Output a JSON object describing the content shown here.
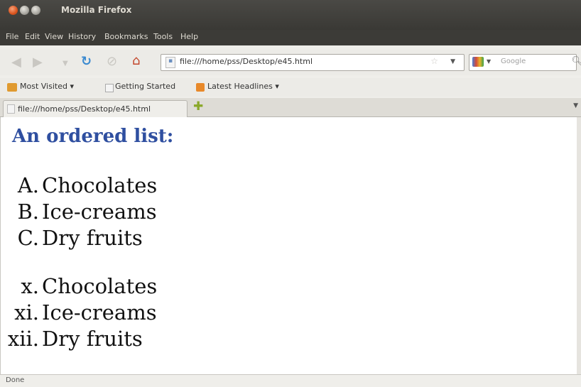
{
  "window": {
    "title": "Mozilla Firefox"
  },
  "menu": [
    "File",
    "Edit",
    "View",
    "History",
    "Bookmarks",
    "Tools",
    "Help"
  ],
  "navigation": {
    "url": "file:///home/pss/Desktop/e45.html",
    "search_placeholder": "Google",
    "icons": [
      "back-icon",
      "forward-icon",
      "history-dropdown-icon",
      "reload-icon",
      "stop-icon",
      "home-icon"
    ]
  },
  "bookmarks": {
    "items": [
      "Most Visited ▾",
      "Getting Started",
      "Latest Headlines ▾"
    ]
  },
  "tab": {
    "label": "file:///home/pss/Desktop/e45.html",
    "new_tab_icon": "plus-icon"
  },
  "page": {
    "heading": "An ordered list:",
    "list_upper_alpha": [
      {
        "marker": "A.",
        "text": "Chocolates"
      },
      {
        "marker": "B.",
        "text": "Ice-creams"
      },
      {
        "marker": "C.",
        "text": "Dry fruits"
      }
    ],
    "list_lower_roman": [
      {
        "marker": "x.",
        "text": "Chocolates"
      },
      {
        "marker": "xi.",
        "text": "Ice-creams"
      },
      {
        "marker": "xii.",
        "text": "Dry fruits"
      }
    ]
  },
  "status": {
    "text": "Done"
  },
  "colors": {
    "heading": "#2f4fa0",
    "titlebar": "#3c3b37"
  }
}
